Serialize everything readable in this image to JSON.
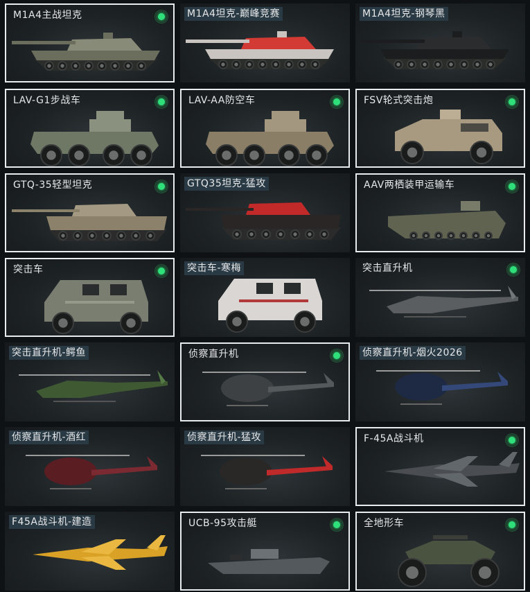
{
  "vehicles": [
    {
      "label": "M1A4主战坦克",
      "owned": true,
      "selected": true,
      "highlight": false,
      "kind": "tank",
      "color": "#6b6e5c",
      "accent": "#888b77"
    },
    {
      "label": "M1A4坦克-巅峰竞赛",
      "owned": false,
      "selected": false,
      "highlight": true,
      "kind": "tank",
      "color": "#c9c4c0",
      "accent": "#d33a33"
    },
    {
      "label": "M1A4坦克-钢琴黑",
      "owned": false,
      "selected": false,
      "highlight": true,
      "kind": "tank",
      "color": "#1c1d1e",
      "accent": "#2b2c2d"
    },
    {
      "label": "LAV-G1步战车",
      "owned": true,
      "selected": true,
      "highlight": false,
      "kind": "apc",
      "color": "#6f7765",
      "accent": "#8a917f"
    },
    {
      "label": "LAV-AA防空车",
      "owned": true,
      "selected": true,
      "highlight": false,
      "kind": "apc",
      "color": "#8a7e67",
      "accent": "#a39780"
    },
    {
      "label": "FSV轮式突击炮",
      "owned": true,
      "selected": true,
      "highlight": false,
      "kind": "armored-car",
      "color": "#a89a80",
      "accent": "#bcae94"
    },
    {
      "label": "GTQ-35轻型坦克",
      "owned": true,
      "selected": true,
      "highlight": false,
      "kind": "light-tank",
      "color": "#8c826b",
      "accent": "#a49a83"
    },
    {
      "label": "GTQ35坦克-猛攻",
      "owned": false,
      "selected": false,
      "highlight": true,
      "kind": "light-tank",
      "color": "#2a2626",
      "accent": "#c22a2a"
    },
    {
      "label": "AAV两栖装甲运输车",
      "owned": true,
      "selected": true,
      "highlight": false,
      "kind": "amphibious",
      "color": "#5f6350",
      "accent": "#777b67"
    },
    {
      "label": "突击车",
      "owned": true,
      "selected": true,
      "highlight": false,
      "kind": "assault-car",
      "color": "#7a7e70",
      "accent": "#959a8b"
    },
    {
      "label": "突击车-寒梅",
      "owned": false,
      "selected": false,
      "highlight": true,
      "kind": "assault-car",
      "color": "#d9d6d3",
      "accent": "#b03a3a"
    },
    {
      "label": "突击直升机",
      "owned": true,
      "selected": false,
      "highlight": false,
      "kind": "attack-heli",
      "color": "#5a5e60",
      "accent": "#72777a"
    },
    {
      "label": "突击直升机-鳄鱼",
      "owned": false,
      "selected": false,
      "highlight": true,
      "kind": "attack-heli",
      "color": "#3f5a33",
      "accent": "#567a45"
    },
    {
      "label": "侦察直升机",
      "owned": true,
      "selected": true,
      "highlight": false,
      "kind": "scout-heli",
      "color": "#3d4144",
      "accent": "#54595c"
    },
    {
      "label": "侦察直升机-烟火2026",
      "owned": false,
      "selected": false,
      "highlight": true,
      "kind": "scout-heli",
      "color": "#1e2a44",
      "accent": "#34487a"
    },
    {
      "label": "侦察直升机-酒红",
      "owned": false,
      "selected": false,
      "highlight": true,
      "kind": "scout-heli",
      "color": "#5a1e22",
      "accent": "#7a2a30"
    },
    {
      "label": "侦察直升机-猛攻",
      "owned": false,
      "selected": false,
      "highlight": true,
      "kind": "scout-heli",
      "color": "#2a2727",
      "accent": "#c02a2a"
    },
    {
      "label": "F-45A战斗机",
      "owned": true,
      "selected": true,
      "highlight": false,
      "kind": "jet",
      "color": "#4a4e52",
      "accent": "#62676b"
    },
    {
      "label": "F45A战斗机-建造",
      "owned": false,
      "selected": false,
      "highlight": true,
      "kind": "jet",
      "color": "#d9a126",
      "accent": "#eab840"
    },
    {
      "label": "UCB-95攻击艇",
      "owned": true,
      "selected": true,
      "highlight": false,
      "kind": "boat",
      "color": "#54595d",
      "accent": "#6c7175"
    },
    {
      "label": "全地形车",
      "owned": true,
      "selected": true,
      "highlight": false,
      "kind": "atv",
      "color": "#4a5240",
      "accent": "#626b56"
    }
  ]
}
